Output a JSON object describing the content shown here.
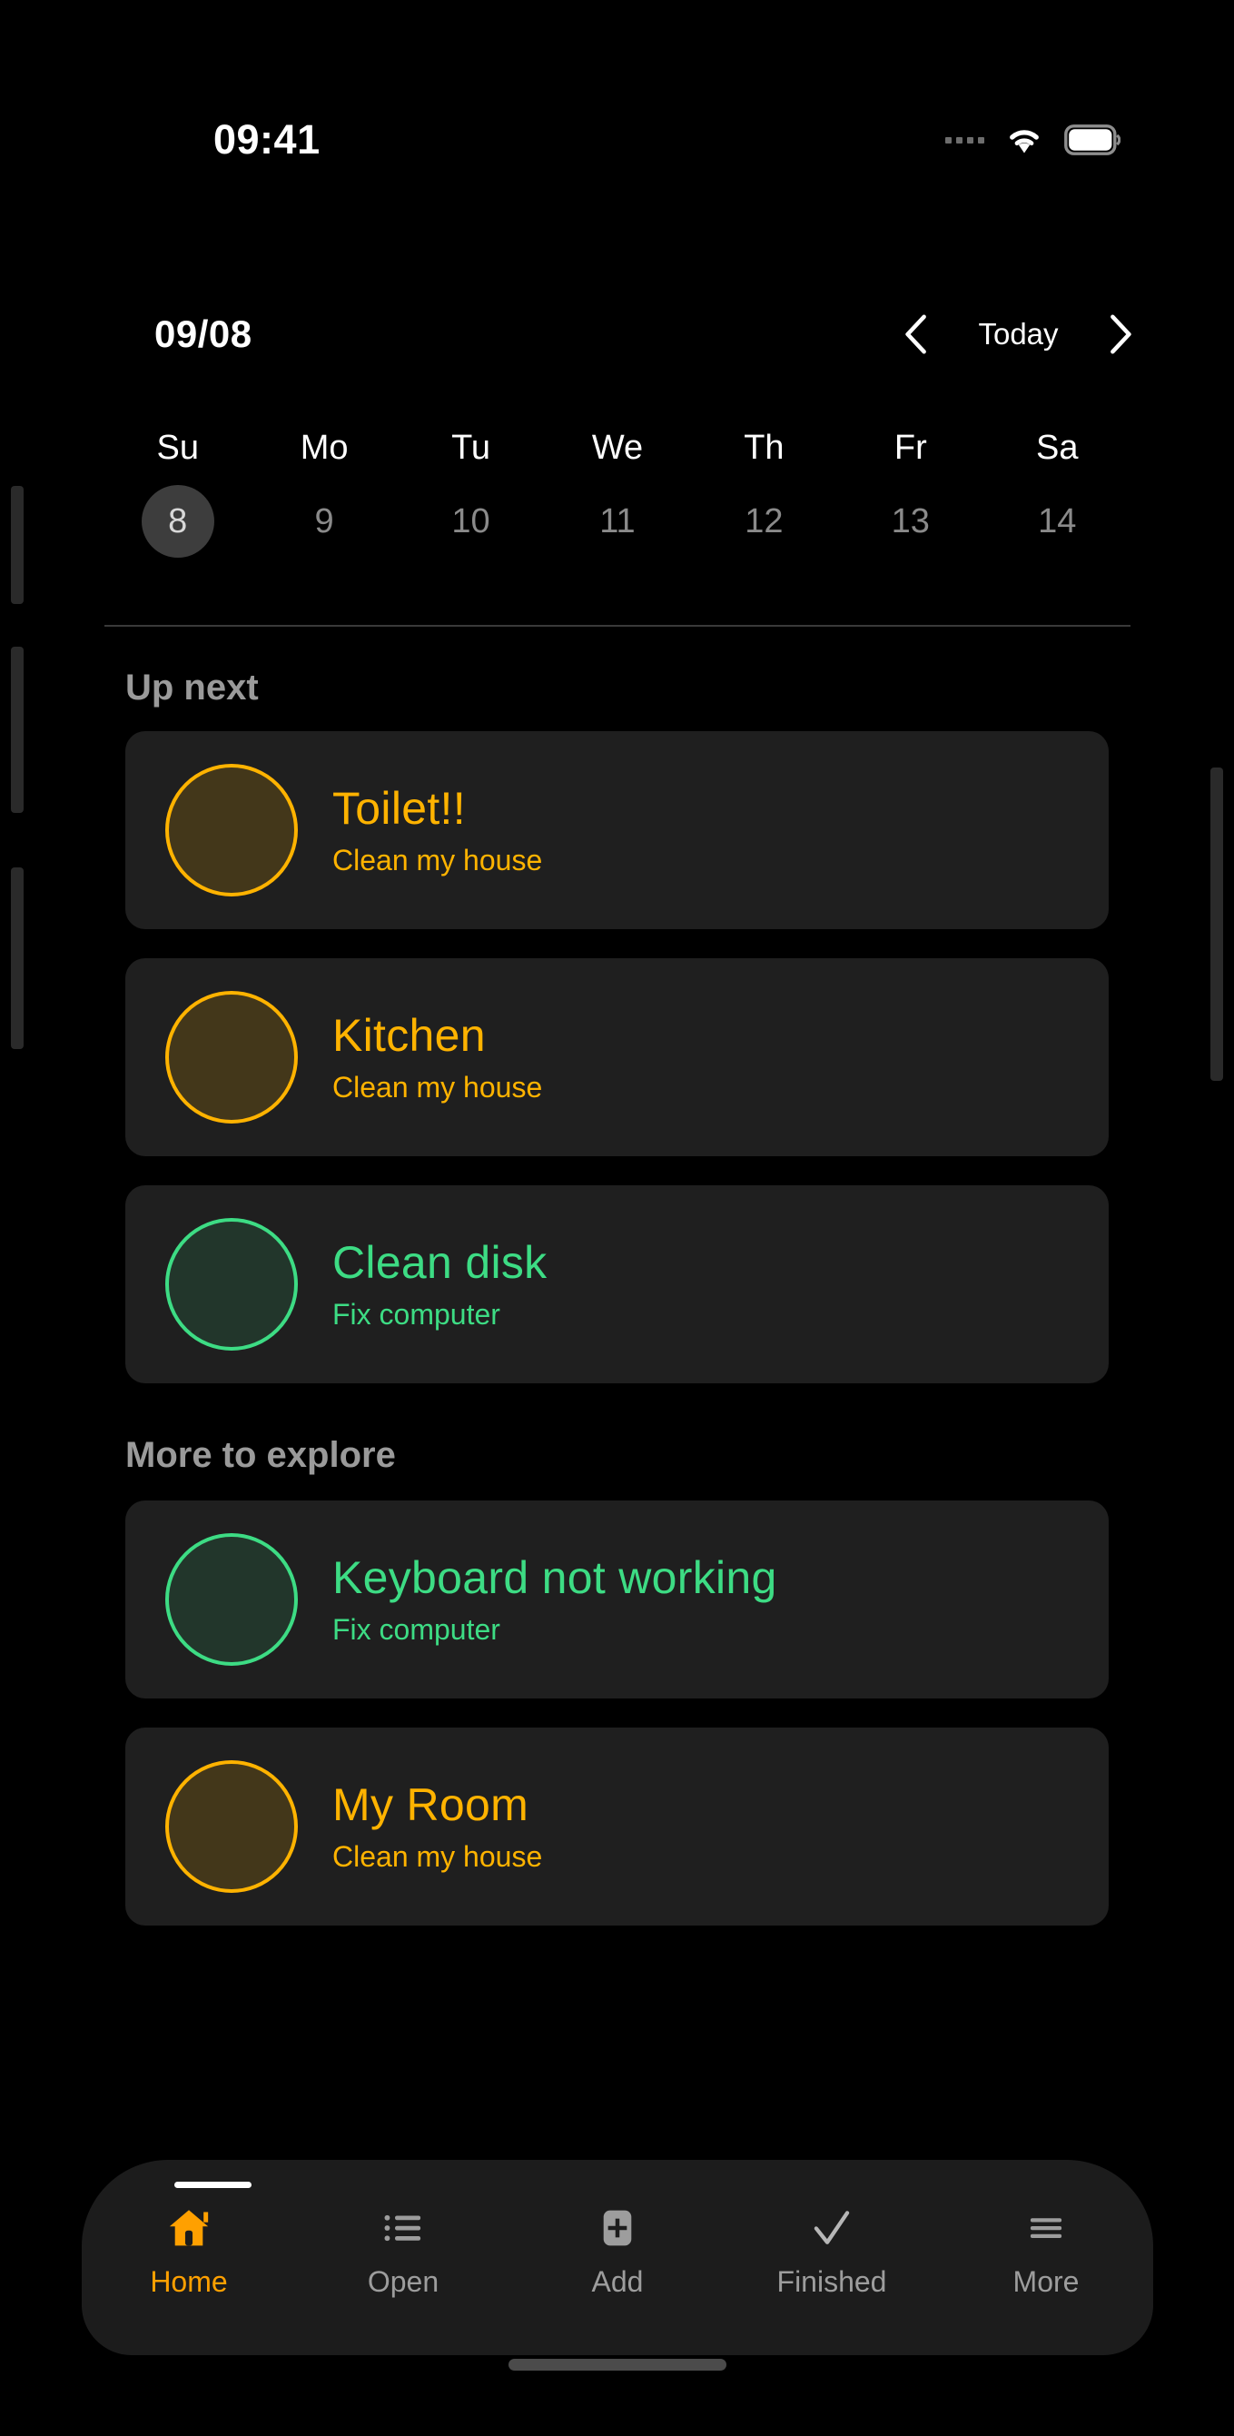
{
  "status_bar": {
    "time": "09:41",
    "signal_icon": "signal-dots-icon",
    "wifi_icon": "wifi-icon",
    "battery_icon": "battery-icon"
  },
  "header": {
    "date": "09/08",
    "prev_icon": "chevron-left-icon",
    "today_label": "Today",
    "next_icon": "chevron-right-icon"
  },
  "week_strip": {
    "days": [
      {
        "dow": "Su",
        "num": "8",
        "selected": true
      },
      {
        "dow": "Mo",
        "num": "9",
        "selected": false
      },
      {
        "dow": "Tu",
        "num": "10",
        "selected": false
      },
      {
        "dow": "We",
        "num": "11",
        "selected": false
      },
      {
        "dow": "Th",
        "num": "12",
        "selected": false
      },
      {
        "dow": "Fr",
        "num": "13",
        "selected": false
      },
      {
        "dow": "Sa",
        "num": "14",
        "selected": false
      }
    ]
  },
  "sections": {
    "up_next": {
      "title": "Up next",
      "items": [
        {
          "title": "Toilet!!",
          "subtitle": "Clean my house",
          "color": "#FFB300",
          "theme": "amber"
        },
        {
          "title": "Kitchen",
          "subtitle": "Clean my house",
          "color": "#FFB300",
          "theme": "amber"
        },
        {
          "title": "Clean disk",
          "subtitle": "Fix computer",
          "color": "#3ddc84",
          "theme": "green"
        }
      ]
    },
    "more_to_explore": {
      "title": "More to explore",
      "items": [
        {
          "title": "Keyboard not working",
          "subtitle": "Fix computer",
          "color": "#3ddc84",
          "theme": "green"
        },
        {
          "title": "My Room",
          "subtitle": "Clean my house",
          "color": "#FFB300",
          "theme": "amber"
        }
      ]
    }
  },
  "bottom_nav": {
    "items": [
      {
        "label": "Home",
        "icon": "home-icon",
        "active": true
      },
      {
        "label": "Open",
        "icon": "list-icon",
        "active": false
      },
      {
        "label": "Add",
        "icon": "plus-box-icon",
        "active": false
      },
      {
        "label": "Finished",
        "icon": "check-icon",
        "active": false
      },
      {
        "label": "More",
        "icon": "hamburger-icon",
        "active": false
      }
    ]
  },
  "colors": {
    "background": "#000000",
    "card": "#1f1f1f",
    "amber": "#FFB300",
    "green": "#3ddc84",
    "muted": "#9a9a9a",
    "accent_nav": "#FFA000"
  }
}
